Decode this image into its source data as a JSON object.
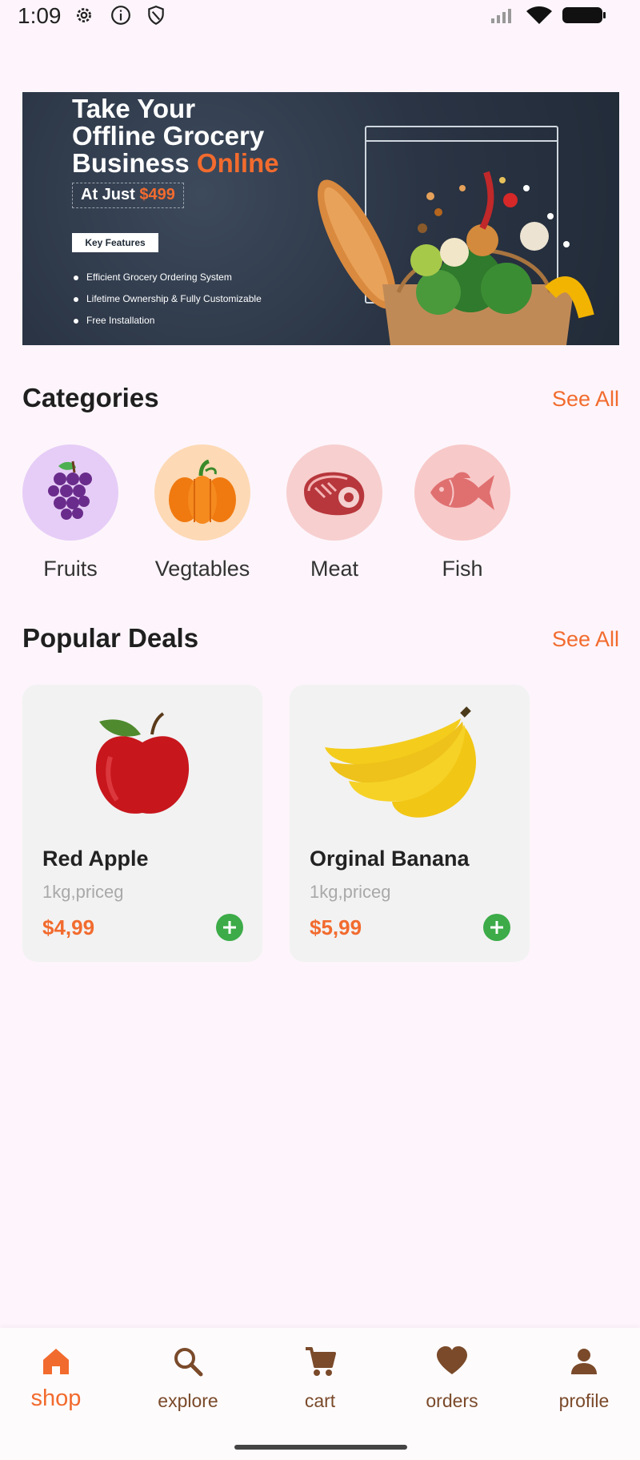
{
  "status_bar": {
    "time": "1:09",
    "icons": [
      "gear-icon",
      "info-icon",
      "shield-icon",
      "signal-icon",
      "wifi-icon",
      "battery-icon"
    ]
  },
  "banner": {
    "title_line1": "Take Your",
    "title_line2": "Offline Grocery",
    "title_line3": "Business",
    "title_accent": "Online",
    "price_prefix": "At Just",
    "price": "$499",
    "key_features_label": "Key Features",
    "features": [
      "Efficient Grocery Ordering System",
      "Lifetime Ownership & Fully Customizable",
      "Free Installation"
    ]
  },
  "categories": {
    "title": "Categories",
    "see_all": "See All",
    "items": [
      {
        "label": "Fruits",
        "icon": "grapes-icon",
        "bg": "#e6cdf7"
      },
      {
        "label": "Vegtables",
        "icon": "pumpkin-icon",
        "bg": "#fdd9b5"
      },
      {
        "label": "Meat",
        "icon": "steak-icon",
        "bg": "#f7cfcf"
      },
      {
        "label": "Fish",
        "icon": "fish-icon",
        "bg": "#f8c9c9"
      }
    ]
  },
  "popular_deals": {
    "title": "Popular Deals",
    "see_all": "See All",
    "items": [
      {
        "name": "Red Apple",
        "unit": "1kg,priceg",
        "price": "$4,99",
        "image": "apple-image"
      },
      {
        "name": "Orginal Banana",
        "unit": "1kg,priceg",
        "price": "$5,99",
        "image": "banana-image"
      }
    ]
  },
  "bottom_nav": {
    "items": [
      {
        "label": "shop",
        "icon": "home-icon",
        "active": true
      },
      {
        "label": "explore",
        "icon": "search-icon",
        "active": false
      },
      {
        "label": "cart",
        "icon": "cart-icon",
        "active": false
      },
      {
        "label": "orders",
        "icon": "heart-icon",
        "active": false
      },
      {
        "label": "profile",
        "icon": "person-icon",
        "active": false
      }
    ]
  },
  "colors": {
    "accent": "#f26b2e",
    "add_button": "#3cab48",
    "nav_inactive": "#7a4a2a",
    "background": "#fdf5fb"
  }
}
